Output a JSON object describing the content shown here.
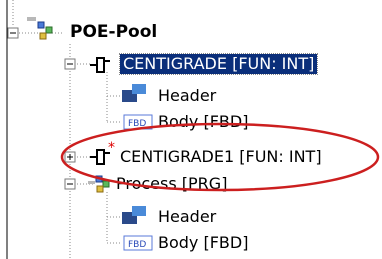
{
  "tree": {
    "root": {
      "label": "POE-Pool",
      "expanded": true
    },
    "nodes": [
      {
        "label": "CENTIGRADE [FUN: INT]",
        "expanded": true,
        "selected": true,
        "children": [
          {
            "label": "Header",
            "icon": "header-icon"
          },
          {
            "label": "Body [FBD]",
            "icon": "fbd-body-icon",
            "icon_text": "FBD"
          }
        ]
      },
      {
        "label": "CENTIGRADE1 [FUN: INT]",
        "expanded": false,
        "highlighted": true,
        "marker": "*"
      },
      {
        "label": "Process [PRG]",
        "expanded": true,
        "children": [
          {
            "label": "Header",
            "icon": "header-icon"
          },
          {
            "label": "Body [FBD]",
            "icon": "fbd-body-icon",
            "icon_text": "FBD"
          }
        ]
      }
    ]
  },
  "colors": {
    "selection": "#0a2e7a",
    "highlight_ellipse": "#cc1f1f",
    "tree_lines": "#8a8a8a"
  }
}
